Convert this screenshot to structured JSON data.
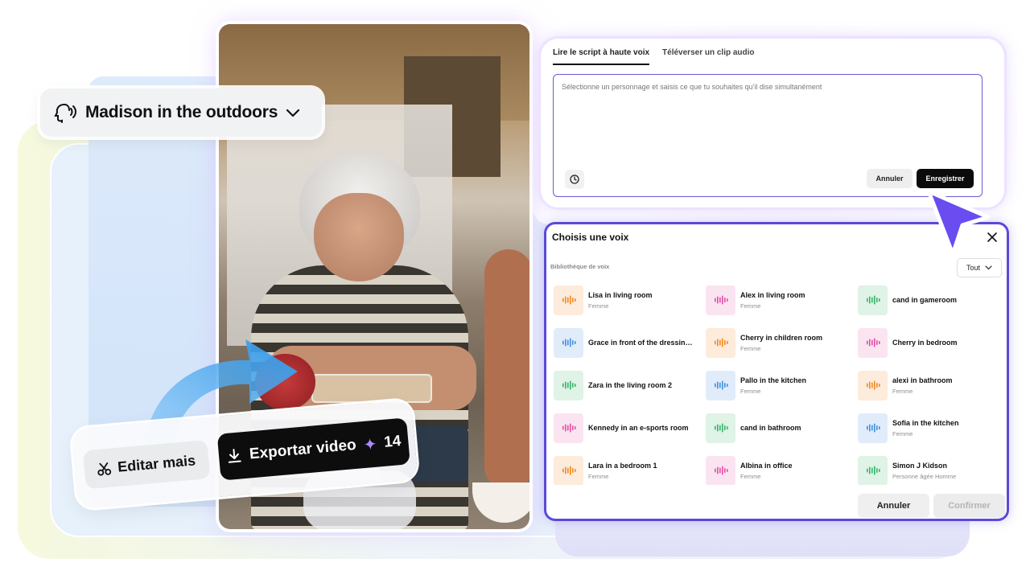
{
  "voice_pill": {
    "label": "Madison in the outdoors"
  },
  "actions": {
    "edit_label": "Editar mais",
    "export_label": "Exportar video",
    "export_credits": "14"
  },
  "script_panel": {
    "tabs": [
      {
        "label": "Lire le script à haute voix",
        "active": true
      },
      {
        "label": "Téléverser un clip audio",
        "active": false
      }
    ],
    "placeholder": "Sélectionne un personnage et saisis ce que tu souhaites qu'il dise simultanément",
    "cancel_label": "Annuler",
    "save_label": "Enregistrer"
  },
  "voice_dialog": {
    "title": "Choisis une voix",
    "library_label": "Bibliothèque de voix",
    "filter_value": "Tout",
    "cancel_label": "Annuler",
    "confirm_label": "Confirmer",
    "voices": [
      {
        "name": "Lisa in living room",
        "sub": "Femme",
        "color": "#f0891f",
        "bg": "#fdebdc"
      },
      {
        "name": "Alex in living room",
        "sub": "Femme",
        "color": "#e04fa6",
        "bg": "#fbe4f1"
      },
      {
        "name": "cand in gameroom",
        "sub": "",
        "color": "#36b36a",
        "bg": "#dff3e6"
      },
      {
        "name": "Grace in front of the dressing table",
        "sub": "",
        "color": "#3f8fe0",
        "bg": "#e1ecfb"
      },
      {
        "name": "Cherry in children room",
        "sub": "Femme",
        "color": "#f0891f",
        "bg": "#fdebdc"
      },
      {
        "name": "Cherry in bedroom",
        "sub": "",
        "color": "#e04fa6",
        "bg": "#fbe4f1"
      },
      {
        "name": "Zara in the living room 2",
        "sub": "",
        "color": "#36b36a",
        "bg": "#dff3e6"
      },
      {
        "name": "Pallo in the kitchen",
        "sub": "Femme",
        "color": "#3f8fe0",
        "bg": "#e1ecfb"
      },
      {
        "name": "alexi in bathroom",
        "sub": "Femme",
        "color": "#f0891f",
        "bg": "#fdebdc"
      },
      {
        "name": "Kennedy in an e-sports room",
        "sub": "",
        "color": "#e04fa6",
        "bg": "#fbe4f1"
      },
      {
        "name": "cand in bathroom",
        "sub": "",
        "color": "#36b36a",
        "bg": "#dff3e6"
      },
      {
        "name": "Sofia in the kitchen",
        "sub": "Femme",
        "color": "#3f8fe0",
        "bg": "#e1ecfb"
      },
      {
        "name": "Lara in a bedroom 1",
        "sub": "Femme",
        "color": "#f0891f",
        "bg": "#fdebdc"
      },
      {
        "name": "Albina in office",
        "sub": "Femme",
        "color": "#e04fa6",
        "bg": "#fbe4f1"
      },
      {
        "name": "Simon J Kidson",
        "sub": "Personne âgée Homme",
        "color": "#36b36a",
        "bg": "#dff3e6"
      }
    ]
  },
  "colors": {
    "dialog_border": "#5a49d8",
    "arrow": "#3fa4ee",
    "cursor": "#6a4cf0"
  }
}
